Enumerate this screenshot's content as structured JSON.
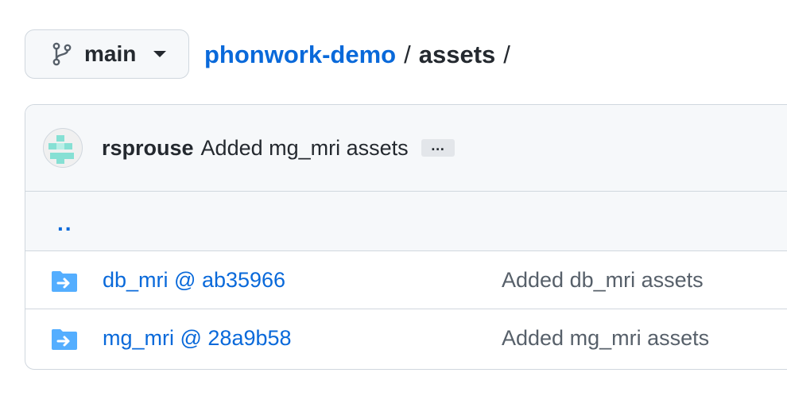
{
  "branch": {
    "icon": "git-branch-icon",
    "name": "main"
  },
  "breadcrumb": {
    "repo": "phonwork-demo",
    "separator": "/",
    "current": "assets",
    "trailing_separator": "/"
  },
  "latest_commit": {
    "avatar_icon": "identicon-avatar",
    "author": "rsprouse",
    "message": "Added mg_mri assets",
    "ellipsis": "…"
  },
  "parent_dir": "..",
  "files": [
    {
      "icon": "submodule-folder-icon",
      "name": "db_mri @ ab35966",
      "commit_message": "Added db_mri assets"
    },
    {
      "icon": "submodule-folder-icon",
      "name": "mg_mri @ 28a9b58",
      "commit_message": "Added mg_mri assets"
    }
  ],
  "colors": {
    "link": "#0969da",
    "text": "#24292f",
    "muted": "#57606a",
    "border": "#d0d7de",
    "header_bg": "#f6f8fa",
    "folder": "#54aeff",
    "avatar_accent": "#86e0d4"
  }
}
